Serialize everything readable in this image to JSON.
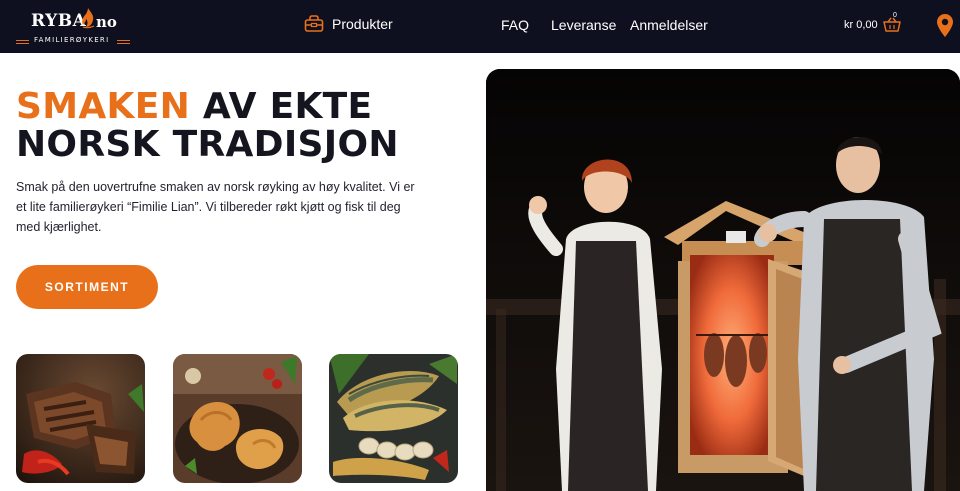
{
  "brand": {
    "name": "RYBA",
    "domain_suffix": "no",
    "tagline": "FAMILIERØYKERI",
    "accent_color": "#e8701a",
    "header_bg": "#0e1020"
  },
  "nav": {
    "products_icon": "basket-icon",
    "products_label": "Produkter",
    "faq_label": "FAQ",
    "delivery_label": "Leveranse",
    "reviews_label": "Anmeldelser"
  },
  "cart": {
    "price": "kr 0,00",
    "count": "0",
    "icon": "cart-icon"
  },
  "location_icon": "map-pin-icon",
  "hero": {
    "headline_accent": "SMAKEN",
    "headline_rest_1": " AV EKTE",
    "headline_line_2": "NORSK TRADISJON",
    "intro": "Smak på den uovertrufne smaken av norsk røyking av høy kvalitet. Vi er et lite familierøykeri “Fimilie Lian”. Vi tilbereder røkt kjøtt og fisk til deg med kjærlighet.",
    "cta_label": "SORTIMENT"
  },
  "thumbnails": [
    {
      "subject": "smoked-meat-ribs"
    },
    {
      "subject": "smoked-chicken-legs"
    },
    {
      "subject": "smoked-mackerel"
    }
  ],
  "hero_image": {
    "subject": "couple-with-outdoor-smokehouse"
  }
}
